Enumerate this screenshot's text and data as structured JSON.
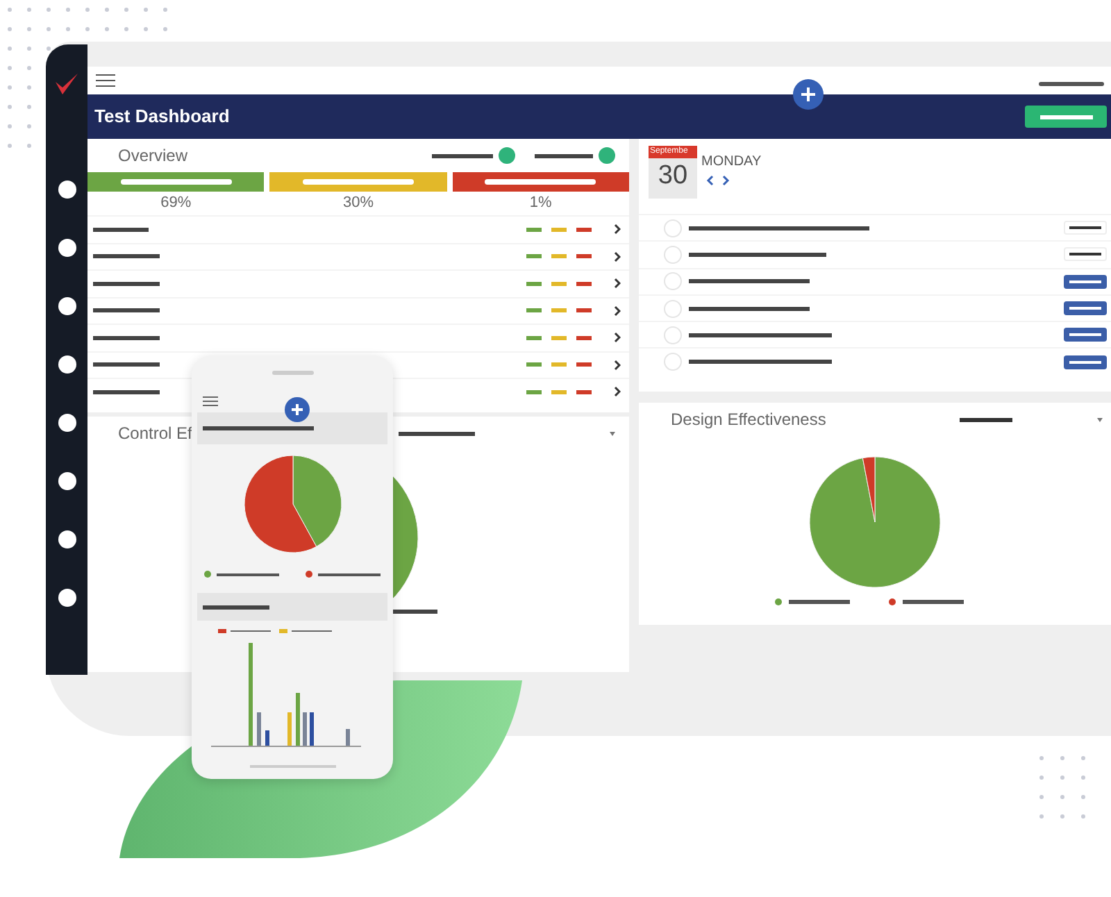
{
  "header": {
    "title": "Test Dashboard"
  },
  "overview": {
    "title": "Overview",
    "toggles": [
      {
        "on": true
      },
      {
        "on": true
      }
    ],
    "segments": [
      {
        "label": "69%",
        "color": "#6ca544"
      },
      {
        "label": "30%",
        "color": "#e2b829"
      },
      {
        "label": "1%",
        "color": "#cf3b28"
      }
    ]
  },
  "calendar": {
    "month": "Septembe",
    "day": "30",
    "weekday": "MONDAY",
    "tasks": [
      {
        "kind": "plain"
      },
      {
        "kind": "plain"
      },
      {
        "kind": "action"
      },
      {
        "kind": "action"
      },
      {
        "kind": "action"
      },
      {
        "kind": "action"
      }
    ]
  },
  "control_card": {
    "title": "Control Ef"
  },
  "design_card": {
    "title": "Design Effectiveness"
  }
}
